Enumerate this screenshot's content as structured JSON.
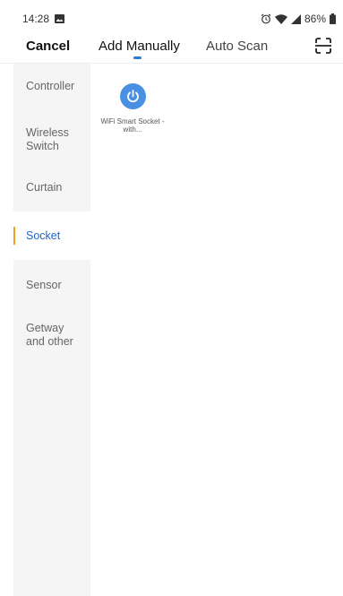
{
  "status_bar": {
    "time": "14:28",
    "battery": "86%",
    "icons": [
      "image-notification-icon",
      "alarm-icon",
      "wifi-icon",
      "signal-icon",
      "battery-icon"
    ]
  },
  "header": {
    "cancel_label": "Cancel",
    "tabs": [
      {
        "label": "Add Manually",
        "selected": true
      },
      {
        "label": "Auto Scan",
        "selected": false
      }
    ],
    "scan_icon": "scan-frame-icon",
    "accent_color": "#2b7bd8"
  },
  "sidebar": {
    "active_color": "#1e64c8",
    "indicator_color": "#f0a020",
    "items": [
      {
        "label": "Controller"
      },
      {
        "label": "Wireless Switch"
      },
      {
        "label": "Curtain"
      },
      {
        "label": "Socket",
        "selected": true
      },
      {
        "label": "Sensor"
      },
      {
        "label": "Getway and other"
      }
    ]
  },
  "devices": [
    {
      "label": "WiFi Smart Socket - with...",
      "icon": "power-icon",
      "icon_color": "#4a90e2"
    }
  ]
}
